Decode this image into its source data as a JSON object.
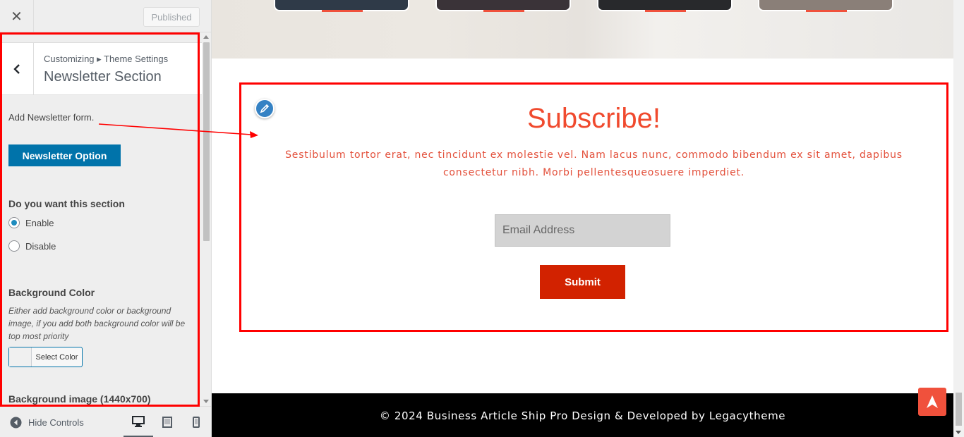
{
  "topbar": {
    "close_icon": "close-icon",
    "published_label": "Published"
  },
  "section_header": {
    "breadcrumb": "Customizing ▸ Theme Settings",
    "title": "Newsletter Section",
    "back_icon": "chevron-left-icon"
  },
  "panel": {
    "description": "Add Newsletter form.",
    "newsletter_option_label": "Newsletter Option",
    "section_toggle": {
      "label": "Do you want this section",
      "options": [
        {
          "label": "Enable",
          "selected": true
        },
        {
          "label": "Disable",
          "selected": false
        }
      ]
    },
    "background_color": {
      "label": "Background Color",
      "note": "Either add background color or background image, if you add both background color will be top most priority",
      "button_label": "Select Color"
    },
    "background_image": {
      "label": "Background image (1440x700)"
    }
  },
  "bottombar": {
    "hide_controls_label": "Hide Controls",
    "devices": [
      "desktop-icon",
      "tablet-icon",
      "mobile-icon"
    ],
    "active_device": "desktop"
  },
  "preview": {
    "subscribe": {
      "title": "Subscribe!",
      "text": "Sestibulum tortor erat, nec tincidunt ex molestie vel. Nam lacus nunc, commodo bibendum ex sit amet, dapibus consectetur nibh. Morbi pellentesqueosuere imperdiet.",
      "email_placeholder": "Email Address",
      "submit_label": "Submit"
    },
    "footer_text": "© 2024 Business Article Ship Pro Design & Developed by Legacytheme"
  },
  "colors": {
    "accent_blue": "#0073aa",
    "title_red": "#f04a2e",
    "submit_red": "#d22200",
    "annotation_red": "#ff0000",
    "footer_bg": "#000000"
  }
}
